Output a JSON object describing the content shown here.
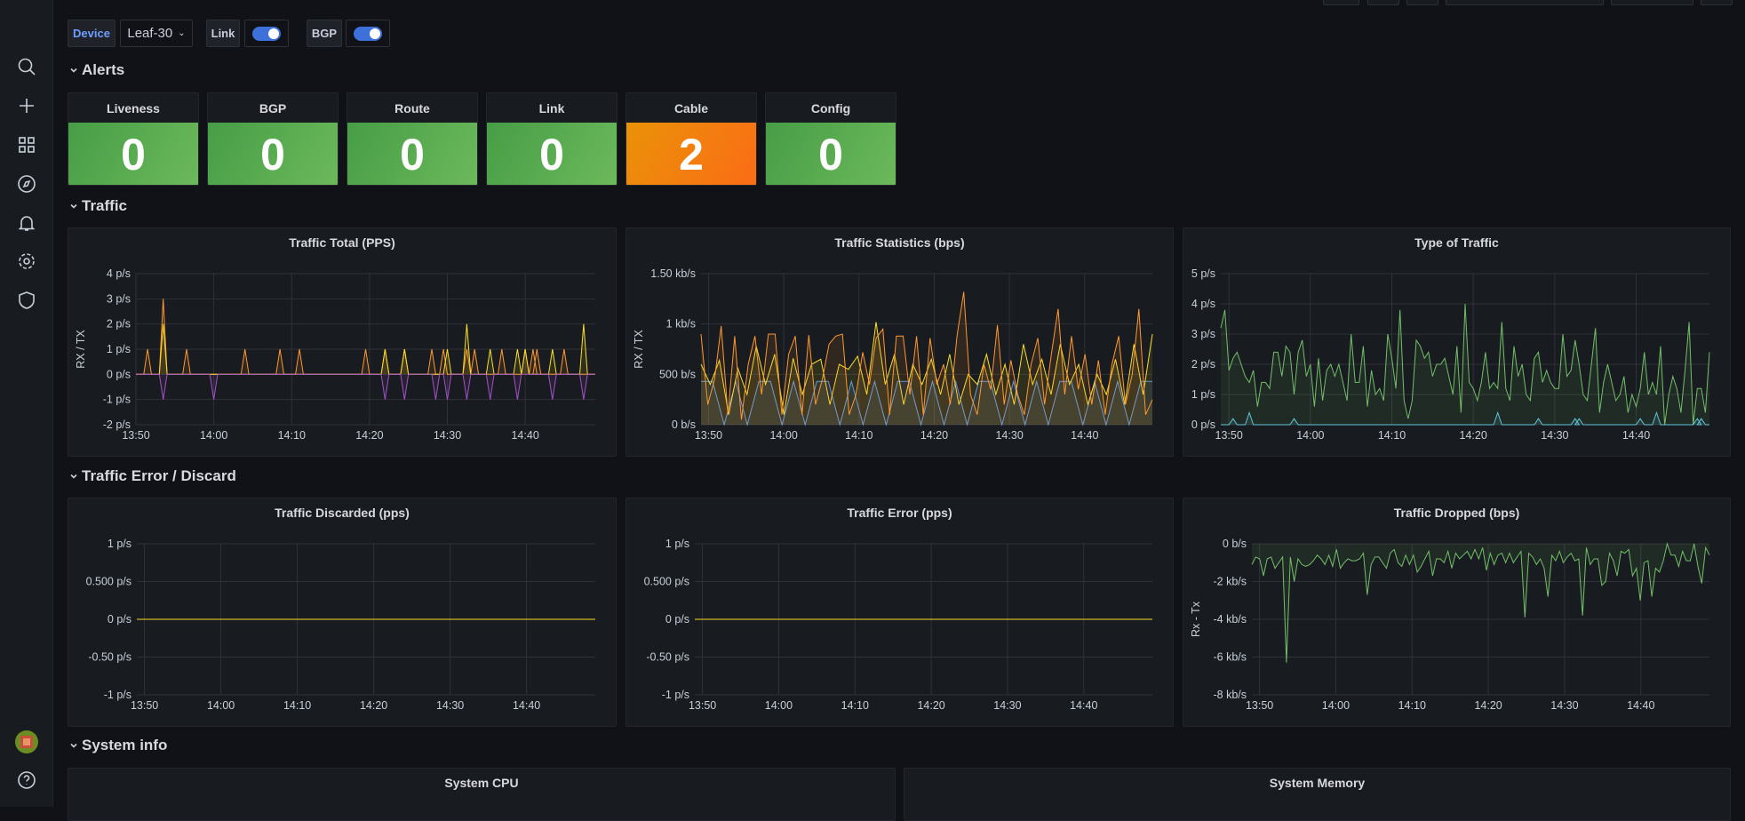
{
  "sidebar": {
    "items": [
      {
        "icon": "search-icon"
      },
      {
        "icon": "plus-icon"
      },
      {
        "icon": "dashboards-icon"
      },
      {
        "icon": "compass-icon"
      },
      {
        "icon": "bell-icon"
      },
      {
        "icon": "gear-icon"
      },
      {
        "icon": "shield-icon"
      }
    ],
    "bottom": [
      {
        "icon": "avatar"
      },
      {
        "icon": "help-icon"
      }
    ]
  },
  "variables": {
    "device_label": "Device",
    "device_value": "Leaf-30",
    "link_label": "Link",
    "link_on": true,
    "bgp_label": "BGP",
    "bgp_on": true
  },
  "sections": {
    "alerts": "Alerts",
    "traffic": "Traffic",
    "errors": "Traffic Error / Discard",
    "system": "System info"
  },
  "stats": [
    {
      "title": "Liveness",
      "value": "0",
      "status": "ok"
    },
    {
      "title": "BGP",
      "value": "0",
      "status": "ok"
    },
    {
      "title": "Route",
      "value": "0",
      "status": "ok"
    },
    {
      "title": "Link",
      "value": "0",
      "status": "ok"
    },
    {
      "title": "Cable",
      "value": "2",
      "status": "warning"
    },
    {
      "title": "Config",
      "value": "0",
      "status": "ok"
    }
  ],
  "colors": {
    "ok": "#56a64b",
    "warning": "#f2780e",
    "orange": "#ff9830",
    "yellow": "#fade2a",
    "purple": "#a352cc",
    "blue": "#5794f2",
    "green": "#73bf69",
    "cyan": "#5fc6d8"
  },
  "chart_data": [
    {
      "title": "Traffic Total (PPS)",
      "type": "line",
      "ylabel": "RX / TX",
      "xrange": [
        "13:50",
        "14:49"
      ],
      "ylim": [
        -2,
        4
      ],
      "yticks": [
        {
          "v": 4,
          "l": "4 p/s"
        },
        {
          "v": 3,
          "l": "3 p/s"
        },
        {
          "v": 2,
          "l": "2 p/s"
        },
        {
          "v": 1,
          "l": "1 p/s"
        },
        {
          "v": 0,
          "l": "0 p/s"
        },
        {
          "v": -1,
          "l": "-1 p/s"
        },
        {
          "v": -2,
          "l": "-2 p/s"
        }
      ],
      "xticks": [
        "13:50",
        "14:00",
        "14:10",
        "14:20",
        "14:30",
        "14:40"
      ],
      "series": [
        {
          "color": "#ff9830",
          "spikes": [
            [
              "13:51:30",
              1
            ],
            [
              "13:53:30",
              3
            ],
            [
              "13:56:30",
              1
            ],
            [
              "14:04:00",
              1
            ],
            [
              "14:08:30",
              1
            ],
            [
              "14:11:00",
              1
            ],
            [
              "14:19:30",
              1
            ],
            [
              "14:22:00",
              1
            ],
            [
              "14:24:30",
              1
            ],
            [
              "14:28:00",
              1
            ],
            [
              "14:29:30",
              1
            ],
            [
              "14:32:30",
              1
            ],
            [
              "14:33:30",
              1
            ],
            [
              "14:37:00",
              1
            ],
            [
              "14:40:00",
              1
            ],
            [
              "14:41:00",
              1
            ],
            [
              "14:41:30",
              1
            ],
            [
              "14:45:00",
              1
            ]
          ]
        },
        {
          "color": "#fade2a",
          "spikes": [
            [
              "13:53:30",
              2
            ],
            [
              "14:22:00",
              1
            ],
            [
              "14:24:30",
              1
            ],
            [
              "14:30:00",
              1
            ],
            [
              "14:32:30",
              2
            ],
            [
              "14:35:30",
              1
            ],
            [
              "14:39:00",
              1
            ],
            [
              "14:40:00",
              1
            ],
            [
              "14:43:30",
              1
            ],
            [
              "14:47:30",
              2
            ]
          ]
        },
        {
          "color": "#a352cc",
          "spikes": [
            [
              "13:53:30",
              -1
            ],
            [
              "14:00:00",
              -1
            ],
            [
              "14:22:00",
              -1
            ],
            [
              "14:24:30",
              -1
            ],
            [
              "14:28:30",
              -1
            ],
            [
              "14:30:00",
              -1
            ],
            [
              "14:32:30",
              -1
            ],
            [
              "14:35:30",
              -1
            ],
            [
              "14:39:00",
              -1
            ],
            [
              "14:43:30",
              -1
            ],
            [
              "14:47:30",
              -1
            ]
          ]
        }
      ]
    },
    {
      "title": "Traffic Statistics (bps)",
      "type": "line",
      "ylabel": "RX / TX",
      "xrange": [
        "13:49",
        "14:49"
      ],
      "ylim": [
        0,
        1500
      ],
      "yticks": [
        {
          "v": 1500,
          "l": "1.50 kb/s"
        },
        {
          "v": 1000,
          "l": "1 kb/s"
        },
        {
          "v": 500,
          "l": "500 b/s"
        },
        {
          "v": 0,
          "l": "0 b/s"
        }
      ],
      "xticks": [
        "13:50",
        "14:00",
        "14:10",
        "14:20",
        "14:30",
        "14:40"
      ],
      "series": [
        {
          "color": "#5794f2",
          "values": [
            430,
            430,
            0,
            430,
            0,
            430,
            430,
            0,
            430,
            0,
            430,
            430,
            0,
            430,
            0,
            430,
            0,
            430,
            430,
            0,
            430,
            0,
            430,
            0,
            430,
            430,
            0,
            430,
            0,
            430,
            0,
            430,
            430,
            0,
            430,
            0,
            430,
            0,
            430,
            430
          ]
        },
        {
          "color": "#fade2a",
          "values": [
            600,
            400,
            640,
            100,
            560,
            300,
            780,
            400,
            700,
            100,
            660,
            300,
            600,
            650,
            200,
            600,
            550,
            680,
            300,
            1020,
            400,
            700,
            200,
            600,
            400,
            650,
            300,
            700,
            200,
            500,
            400,
            700,
            300,
            600,
            200,
            800,
            400,
            650,
            300,
            800,
            400,
            600,
            200,
            500,
            300,
            650,
            200,
            800,
            300,
            900
          ]
        },
        {
          "color": "#ff9830",
          "values": [
            900,
            200,
            450,
            980,
            100,
            880,
            50,
            600,
            880,
            300,
            900,
            900,
            100,
            700,
            880,
            100,
            890,
            200,
            450,
            800,
            880,
            900,
            100,
            300,
            720,
            400,
            860,
            950,
            100,
            880,
            880,
            300,
            880,
            100,
            860,
            400,
            600,
            200,
            880,
            1320,
            300,
            100,
            600,
            350,
            990,
            200,
            640,
            300,
            100,
            600,
            860,
            200,
            700,
            1150,
            300,
            880,
            350,
            700,
            200,
            640,
            100,
            600,
            880,
            200,
            500,
            1150,
            100,
            250
          ]
        }
      ]
    },
    {
      "title": "Type of Traffic",
      "type": "line",
      "ylabel": "",
      "xrange": [
        "13:49",
        "14:49"
      ],
      "ylim": [
        0,
        5
      ],
      "yticks": [
        {
          "v": 5,
          "l": "5 p/s"
        },
        {
          "v": 4,
          "l": "4 p/s"
        },
        {
          "v": 3,
          "l": "3 p/s"
        },
        {
          "v": 2,
          "l": "2 p/s"
        },
        {
          "v": 1,
          "l": "1 p/s"
        },
        {
          "v": 0,
          "l": "0 p/s"
        }
      ],
      "xticks": [
        "13:50",
        "14:00",
        "14:10",
        "14:20",
        "14:30",
        "14:40"
      ],
      "series": [
        {
          "color": "#73bf69",
          "values": [
            3.2,
            3.8,
            1.8,
            2.2,
            2.4,
            2,
            1.6,
            1.4,
            1.8,
            0.6,
            1.4,
            1.4,
            1.2,
            2.4,
            2.4,
            1.6,
            2.6,
            2.4,
            1,
            2.4,
            2.8,
            1.6,
            2,
            0.6,
            2.2,
            0.8,
            1.8,
            2,
            1.6,
            2,
            1.4,
            0.8,
            3,
            1.4,
            1.4,
            2.6,
            0.6,
            1.8,
            1,
            1.2,
            0.8,
            3,
            2.2,
            1.2,
            3.8,
            0.8,
            0.2,
            0.8,
            2.8,
            2.6,
            2.2,
            2.4,
            1.6,
            2,
            2,
            2.2,
            1.6,
            1,
            2.6,
            0.4,
            4,
            1.4,
            1.2,
            0.8,
            1.4,
            2.4,
            1.2,
            1.4,
            1.2,
            3.4,
            1.2,
            0.8,
            2.6,
            1.6,
            2,
            1,
            0.8,
            2.2,
            2.4,
            1.4,
            1.8,
            1.4,
            1.2,
            1.2,
            3,
            1.6,
            1.8,
            2.8,
            2,
            1,
            0.8,
            2,
            3.2,
            0.4,
            1.4,
            2,
            1.4,
            0.8,
            1,
            1.6,
            0.4,
            1,
            0.6,
            1.2,
            2.4,
            1,
            1.4,
            1,
            2.6,
            0,
            1,
            1.6,
            1.2,
            0.4,
            1.8,
            3.4,
            0,
            1.2,
            1.2,
            0.4,
            2.4
          ]
        },
        {
          "color": "#5fc6d8",
          "spikes": [
            [
              "13:50:30",
              0.2
            ],
            [
              "13:52:30",
              0.4
            ],
            [
              "13:58:00",
              0.2
            ],
            [
              "14:23:00",
              0.4
            ],
            [
              "14:28:00",
              0.2
            ],
            [
              "14:32:30",
              0.2
            ],
            [
              "14:33:00",
              0.2
            ],
            [
              "14:40:30",
              0.2
            ],
            [
              "14:42:30",
              0.4
            ],
            [
              "14:47:30",
              0.2
            ],
            [
              "14:48:00",
              0.2
            ]
          ]
        }
      ]
    },
    {
      "title": "Traffic Discarded (pps)",
      "type": "line",
      "ylabel": "",
      "xrange": [
        "13:49",
        "14:49"
      ],
      "ylim": [
        -1,
        1
      ],
      "yticks": [
        {
          "v": 1,
          "l": "1 p/s"
        },
        {
          "v": 0.5,
          "l": "0.500 p/s"
        },
        {
          "v": 0,
          "l": "0 p/s"
        },
        {
          "v": -0.5,
          "l": "-0.50 p/s"
        },
        {
          "v": -1,
          "l": "-1 p/s"
        }
      ],
      "xticks": [
        "13:50",
        "14:00",
        "14:10",
        "14:20",
        "14:30",
        "14:40"
      ],
      "series": [
        {
          "color": "#fade2a",
          "values": [
            0,
            0
          ]
        }
      ]
    },
    {
      "title": "Traffic Error (pps)",
      "type": "line",
      "ylabel": "",
      "xrange": [
        "13:49",
        "14:49"
      ],
      "ylim": [
        -1,
        1
      ],
      "yticks": [
        {
          "v": 1,
          "l": "1 p/s"
        },
        {
          "v": 0.5,
          "l": "0.500 p/s"
        },
        {
          "v": 0,
          "l": "0 p/s"
        },
        {
          "v": -0.5,
          "l": "-0.50 p/s"
        },
        {
          "v": -1,
          "l": "-1 p/s"
        }
      ],
      "xticks": [
        "13:50",
        "14:00",
        "14:10",
        "14:20",
        "14:30",
        "14:40"
      ],
      "series": [
        {
          "color": "#fade2a",
          "values": [
            0,
            0
          ]
        }
      ]
    },
    {
      "title": "Traffic Dropped (bps)",
      "type": "line",
      "ylabel": "Rx - Tx",
      "xrange": [
        "13:49",
        "14:49"
      ],
      "ylim": [
        -8000,
        0
      ],
      "yticks": [
        {
          "v": 0,
          "l": "0 b/s"
        },
        {
          "v": -2000,
          "l": "-2 kb/s"
        },
        {
          "v": -4000,
          "l": "-4 kb/s"
        },
        {
          "v": -6000,
          "l": "-6 kb/s"
        },
        {
          "v": -8000,
          "l": "-8 kb/s"
        }
      ],
      "xticks": [
        "13:50",
        "14:00",
        "14:10",
        "14:20",
        "14:30",
        "14:40"
      ],
      "series": [
        {
          "color": "#73bf69",
          "values": [
            -1100,
            -700,
            -800,
            -1700,
            -800,
            -700,
            -1300,
            -1000,
            -700,
            -6300,
            -700,
            -2000,
            -800,
            -1100,
            -1200,
            -1100,
            -900,
            -600,
            -800,
            -1100,
            -600,
            -1200,
            -300,
            -1300,
            -1000,
            -800,
            -900,
            -900,
            -800,
            -500,
            -2700,
            -1100,
            -700,
            -700,
            -1000,
            -1300,
            -500,
            -300,
            -1000,
            -1200,
            -600,
            -1100,
            -600,
            -1500,
            -1200,
            -800,
            -400,
            -1700,
            -800,
            -800,
            -1000,
            -400,
            -1300,
            -500,
            -800,
            -600,
            -400,
            -800,
            -300,
            -800,
            -200,
            -1400,
            -500,
            -1100,
            -600,
            -500,
            -1000,
            -500,
            -1000,
            -700,
            -400,
            -3900,
            -500,
            -700,
            -1100,
            -800,
            -1300,
            -2800,
            -600,
            -900,
            -400,
            -1000,
            -700,
            -500,
            -900,
            -800,
            -3800,
            -200,
            -1100,
            -800,
            -800,
            -2200,
            -2000,
            -500,
            -900,
            -1700,
            -400,
            -500,
            -300,
            -1700,
            -1300,
            -3000,
            -1000,
            -900,
            -2800,
            -1300,
            -1500,
            -900,
            0,
            -600,
            -600,
            -1200,
            -400,
            -900,
            -900,
            0,
            -1200,
            -2100,
            -200,
            -600
          ]
        }
      ]
    }
  ],
  "system_panels": [
    {
      "title": "System CPU"
    },
    {
      "title": "System Memory"
    }
  ]
}
